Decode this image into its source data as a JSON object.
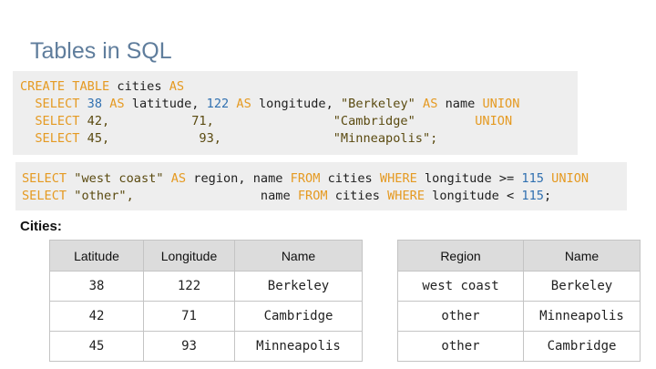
{
  "slide": {
    "title": "Tables in SQL",
    "caption": "Cities:"
  },
  "code_block_1": {
    "lines": [
      [
        {
          "t": "CREATE TABLE",
          "c": "kw"
        },
        {
          "t": " cities ",
          "c": "plain"
        },
        {
          "t": "AS",
          "c": "kw"
        }
      ],
      [
        {
          "t": "  SELECT ",
          "c": "kw"
        },
        {
          "t": "38",
          "c": "num"
        },
        {
          "t": " AS",
          "c": "kw"
        },
        {
          "t": " latitude, ",
          "c": "plain"
        },
        {
          "t": "122",
          "c": "num"
        },
        {
          "t": " AS",
          "c": "kw"
        },
        {
          "t": " longitude, ",
          "c": "plain"
        },
        {
          "t": "\"Berkeley\"",
          "c": "str"
        },
        {
          "t": " AS",
          "c": "kw"
        },
        {
          "t": " name ",
          "c": "plain"
        },
        {
          "t": "UNION",
          "c": "kw"
        }
      ],
      [
        {
          "t": "  SELECT ",
          "c": "kw"
        },
        {
          "t": "42,           71,                \"Cambridge\"        ",
          "c": "str"
        },
        {
          "t": "UNION",
          "c": "kw"
        }
      ],
      [
        {
          "t": "  SELECT ",
          "c": "kw"
        },
        {
          "t": "45,            93,               \"Minneapolis\";",
          "c": "str"
        }
      ]
    ]
  },
  "code_block_2": {
    "lines": [
      [
        {
          "t": "SELECT ",
          "c": "kw"
        },
        {
          "t": "\"west coast\"",
          "c": "str"
        },
        {
          "t": " AS",
          "c": "kw"
        },
        {
          "t": " region, name ",
          "c": "plain"
        },
        {
          "t": "FROM",
          "c": "kw"
        },
        {
          "t": " cities ",
          "c": "plain"
        },
        {
          "t": "WHERE",
          "c": "kw"
        },
        {
          "t": " longitude >= ",
          "c": "plain"
        },
        {
          "t": "115",
          "c": "num"
        },
        {
          "t": " UNION",
          "c": "kw"
        }
      ],
      [
        {
          "t": "SELECT ",
          "c": "kw"
        },
        {
          "t": "\"other\",",
          "c": "str"
        },
        {
          "t": "                 name ",
          "c": "plain"
        },
        {
          "t": "FROM",
          "c": "kw"
        },
        {
          "t": " cities ",
          "c": "plain"
        },
        {
          "t": "WHERE",
          "c": "kw"
        },
        {
          "t": " longitude < ",
          "c": "plain"
        },
        {
          "t": "115",
          "c": "num"
        },
        {
          "t": ";",
          "c": "plain"
        }
      ]
    ]
  },
  "cities_table": {
    "headers": [
      "Latitude",
      "Longitude",
      "Name"
    ],
    "rows": [
      [
        "38",
        "122",
        "Berkeley"
      ],
      [
        "42",
        "71",
        "Cambridge"
      ],
      [
        "45",
        "93",
        "Minneapolis"
      ]
    ]
  },
  "regions_table": {
    "headers": [
      "Region",
      "Name"
    ],
    "rows": [
      [
        "west coast",
        "Berkeley"
      ],
      [
        "other",
        "Minneapolis"
      ],
      [
        "other",
        "Cambridge"
      ]
    ]
  },
  "colors": {
    "keyword": "#e59a22",
    "number": "#3070b0",
    "string": "#5a4a10",
    "title": "#5f7d9c",
    "code_bg": "#eeeeee",
    "header_bg": "#dcdcdc"
  }
}
